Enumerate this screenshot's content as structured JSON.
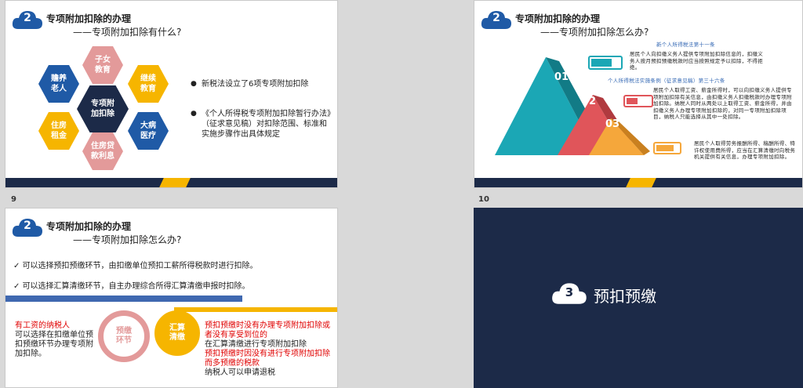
{
  "slides": [
    {
      "num": "2",
      "title": "专项附加扣除的办理",
      "subtitle": "——专项附加扣除有什么?",
      "hexes": [
        "子女\n教育",
        "赡养\n老人",
        "继续\n教育",
        "专项附\n加扣除",
        "住房\n租金",
        "大病\n医疗",
        "住房贷\n款利息"
      ],
      "bullets": [
        "新税法设立了6项专项附加扣除",
        "《个人所得税专项附加扣除暂行办法》（征求意见稿）对扣除范围、标准和实施步骤作出具体规定"
      ],
      "page_number": "9"
    },
    {
      "num": "2",
      "title": "专项附加扣除的办理",
      "subtitle": "——专项附加扣除怎么办?",
      "steps": [
        "01",
        "02",
        "03"
      ],
      "heading1": "新个人所得税法第十一条",
      "para1": "居民个人向扣缴义务人提供专项附加扣除信息的，扣缴义务人按月预扣预缴税款时应当按照规定予以扣除，不得拒绝。",
      "heading2": "个人所得税法实施条例（征求意见稿）第三十六条",
      "para2": "居民个人取得工资、薪金所得时，可以向扣缴义务人提供专项附加扣除有关信息，由扣缴义务人扣缴税款时办理专项附加扣除。纳税人同时从两处以上取得工资、薪金所得，并由扣缴义务人办理专项附加扣除的，对同一专项附加扣除项目，纳税人只能选择从其中一处扣除。",
      "para3": "居民个人取得劳务报酬所得、稿酬所得、特许权使用费所得，应当在汇算清缴时向税务机关提供有关信息，办理专项附加扣除。",
      "page_number": "10"
    },
    {
      "num": "2",
      "title": "专项附加扣除的办理",
      "subtitle": "——专项附加扣除怎么办?",
      "checks": [
        "可以选择预扣预缴环节，由扣缴单位预扣工薪所得税款时进行扣除。",
        "可以选择汇算清缴环节，自主办理综合所得汇算清缴申报时扣除。"
      ],
      "left_red": "有工资的纳税人",
      "left_black": "可以选择在扣缴单位预扣预缴环节办理专项附加扣除。",
      "circle1": "预缴\n环节",
      "circle2": "汇算\n清缴",
      "right_red1": "预扣预缴时没有办理专项附加扣除或者没有享受到位的",
      "right_black1": "在汇算清缴进行专项附加扣除",
      "right_red2": "预扣预缴时因没有进行专项附加扣除而多预缴的税款",
      "right_black2": "纳税人可以申请退税"
    },
    {
      "num": "3",
      "title": "预扣预缴"
    }
  ],
  "colors": {
    "navy": "#1c2a48",
    "gold": "#f6b500",
    "blue": "#1f5aa6",
    "pink": "#e39a9a",
    "teal": "#1ba7b5",
    "red": "#e0555a",
    "orange": "#f5a73b"
  }
}
